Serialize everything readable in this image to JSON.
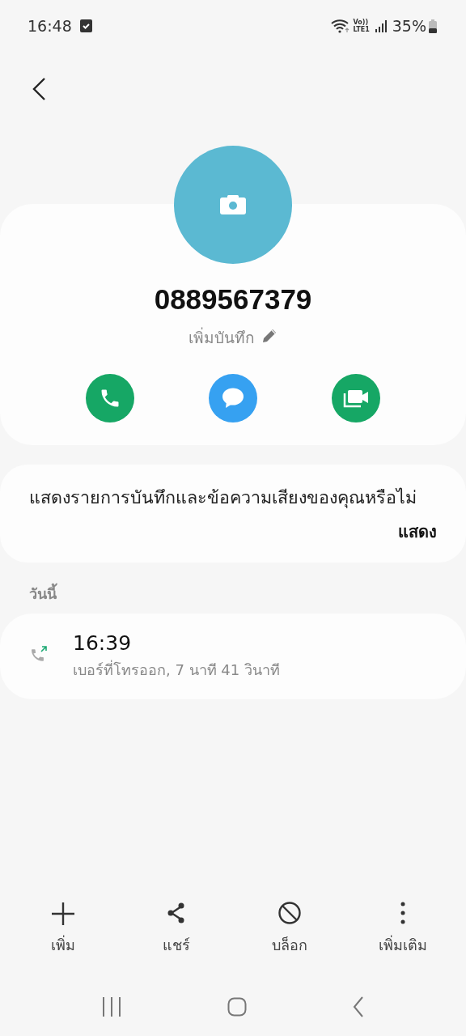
{
  "status_bar": {
    "time": "16:48",
    "volte": "Vo))",
    "network": "LTE1",
    "battery": "35%"
  },
  "contact": {
    "number": "0889567379",
    "note": "เพิ่มบันทึก"
  },
  "quick_actions": [
    {
      "kind": "call"
    },
    {
      "kind": "message"
    },
    {
      "kind": "video"
    }
  ],
  "prompt": {
    "text": "แสดงรายการบันทึกและข้อความเสียงของคุณหรือไม่",
    "button": "แสดง"
  },
  "section": "วันนี้",
  "calls": [
    {
      "kind": "outgoing",
      "time": "16:39",
      "detail": "เบอร์ที่โทรออก, 7 นาที 41 วินาที"
    }
  ],
  "actions": [
    {
      "kind": "add",
      "label": "เพิ่ม"
    },
    {
      "kind": "share",
      "label": "แชร์"
    },
    {
      "kind": "block",
      "label": "บล็อก"
    },
    {
      "kind": "more",
      "label": "เพิ่มเติม"
    }
  ]
}
